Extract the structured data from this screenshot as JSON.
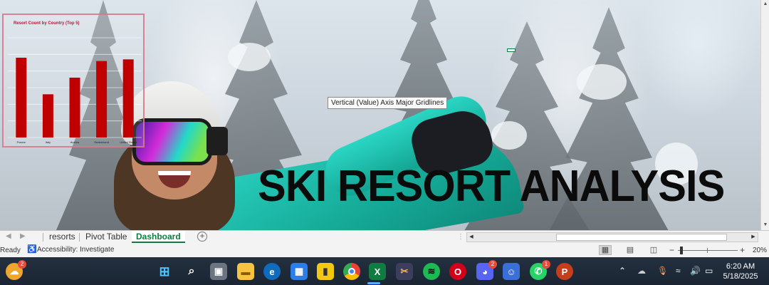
{
  "sheet": {
    "title": "SKI RESORT ANALYSIS",
    "tooltip": "Vertical (Value) Axis Major Gridlines"
  },
  "chart_data": {
    "type": "bar",
    "title": "Resort Count by Country (Top 5)",
    "categories": [
      "France",
      "Italy",
      "Austria",
      "Switzerland",
      "United States"
    ],
    "values": [
      24,
      13,
      18,
      23,
      23.5
    ],
    "ylim": [
      0,
      30
    ],
    "grid": true,
    "legend": "none",
    "bar_color": "#c00000"
  },
  "sheet_tabs": {
    "tabs": [
      {
        "label": "resorts",
        "active": false
      },
      {
        "label": "Pivot Table",
        "active": false
      },
      {
        "label": "Dashboard",
        "active": true
      }
    ],
    "add_label": "+"
  },
  "status_bar": {
    "ready": "Ready",
    "accessibility": "Accessibility: Investigate",
    "zoom": "20%"
  },
  "taskbar": {
    "weather_badge": "2",
    "discord_badge": "2",
    "whatsapp_badge": "1",
    "time": "6:20 AM",
    "date": "5/18/2025"
  },
  "colors": {
    "excel_green": "#107c41",
    "taskbar_bg": "#1f2a3a",
    "bar": "#c00000"
  }
}
